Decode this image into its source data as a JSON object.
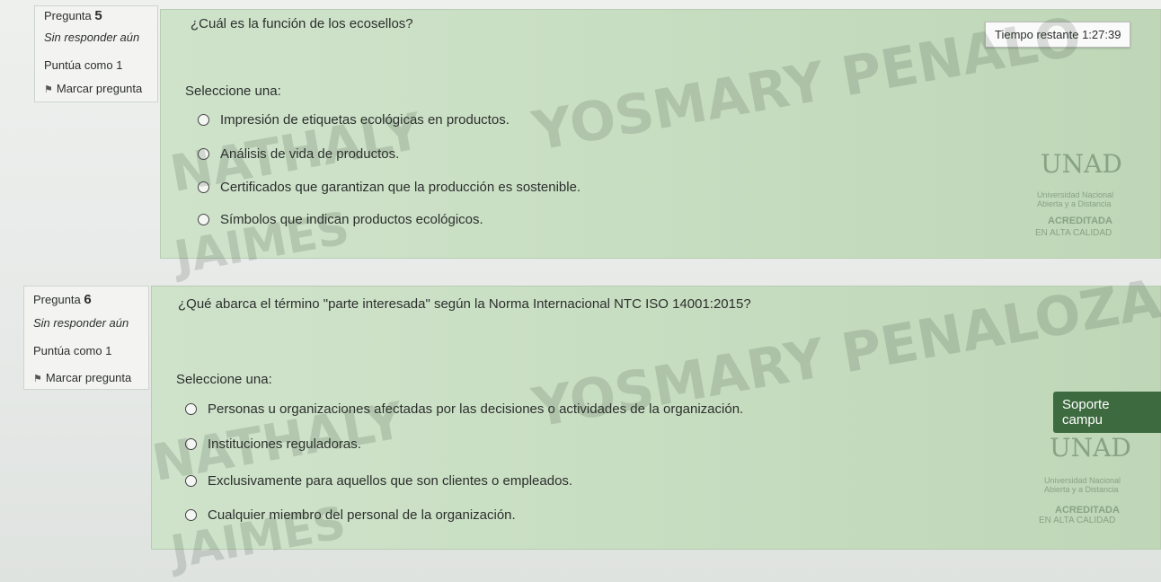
{
  "questions": [
    {
      "label": "Pregunta",
      "number": "5",
      "status": "Sin responder aún",
      "points": "Puntúa como 1",
      "flag_label": "Marcar pregunta",
      "text": "¿Cuál es la función de los ecosellos?",
      "select_label": "Seleccione una:",
      "options": [
        "Impresión de etiquetas ecológicas en productos.",
        "Análisis de vida de productos.",
        "Certificados que garantizan que la producción es sostenible.",
        "Símbolos que indican productos ecológicos."
      ]
    },
    {
      "label": "Pregunta",
      "number": "6",
      "status": "Sin responder aún",
      "points": "Puntúa como 1",
      "flag_label": "Marcar pregunta",
      "text": "¿Qué abarca el término \"parte interesada\" según la Norma Internacional NTC ISO 14001:2015?",
      "select_label": "Seleccione una:",
      "options": [
        "Personas u organizaciones afectadas por las decisiones o actividades de la organización.",
        "Instituciones reguladoras.",
        "Exclusivamente para aquellos que son clientes o empleados.",
        "Cualquier miembro del personal de la organización."
      ]
    }
  ],
  "timer": {
    "label": "Tiempo restante",
    "value": "1:27:39"
  },
  "support_button": "Soporte campu",
  "watermark": {
    "line1": "YOSMARY PENALO",
    "line1b": "YOSMARY PENALOZA",
    "line2": "NATHALY",
    "line3": "JAIMES"
  },
  "logo": {
    "name": "UNAD",
    "subtitle1": "Universidad Nacional",
    "subtitle2": "Abierta y a Distancia",
    "badge1": "ACREDITADA",
    "badge2": "EN ALTA CALIDAD"
  },
  "colors": {
    "panel": "#c9dfc3",
    "support": "#3d6b3f"
  }
}
